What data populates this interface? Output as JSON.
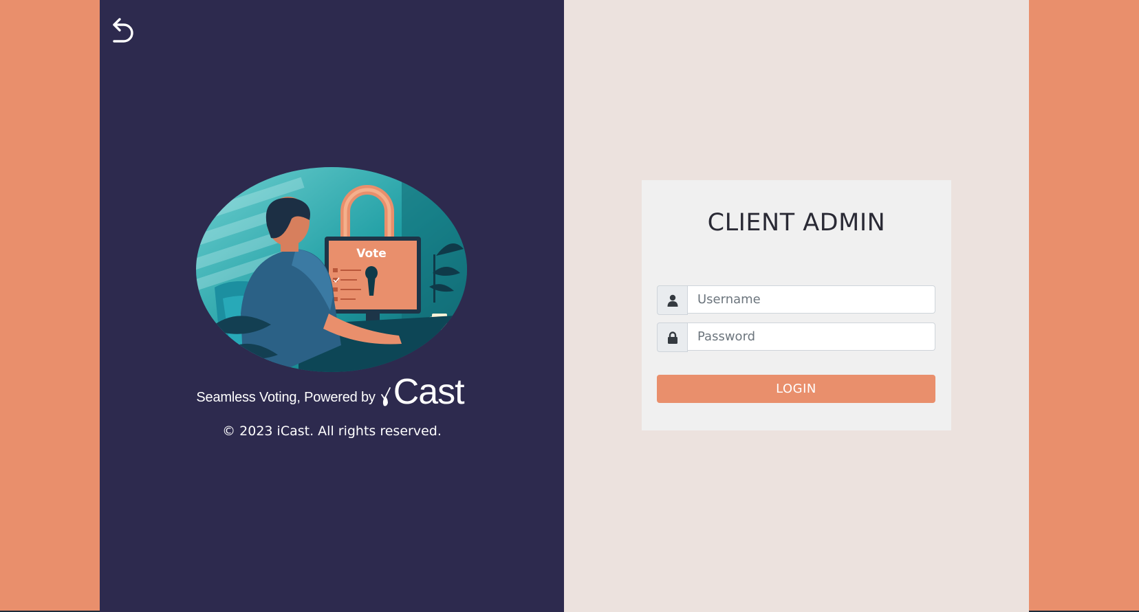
{
  "colors": {
    "page_background": "#e98f6c",
    "left_panel": "#2d2a4e",
    "right_panel": "#ece2de",
    "card": "#f0f0f0",
    "accent": "#e98f6c"
  },
  "header": {
    "back_icon": "back-arrow-icon"
  },
  "branding": {
    "illustration_label": "Vote",
    "tagline": "Seamless Voting, Powered by",
    "brand_name": "Cast",
    "copyright": "© 2023 iCast. All rights reserved."
  },
  "login": {
    "title": "CLIENT ADMIN",
    "username": {
      "icon": "user-icon",
      "placeholder": "Username",
      "value": ""
    },
    "password": {
      "icon": "lock-icon",
      "placeholder": "Password",
      "value": ""
    },
    "submit_label": "LOGIN"
  }
}
